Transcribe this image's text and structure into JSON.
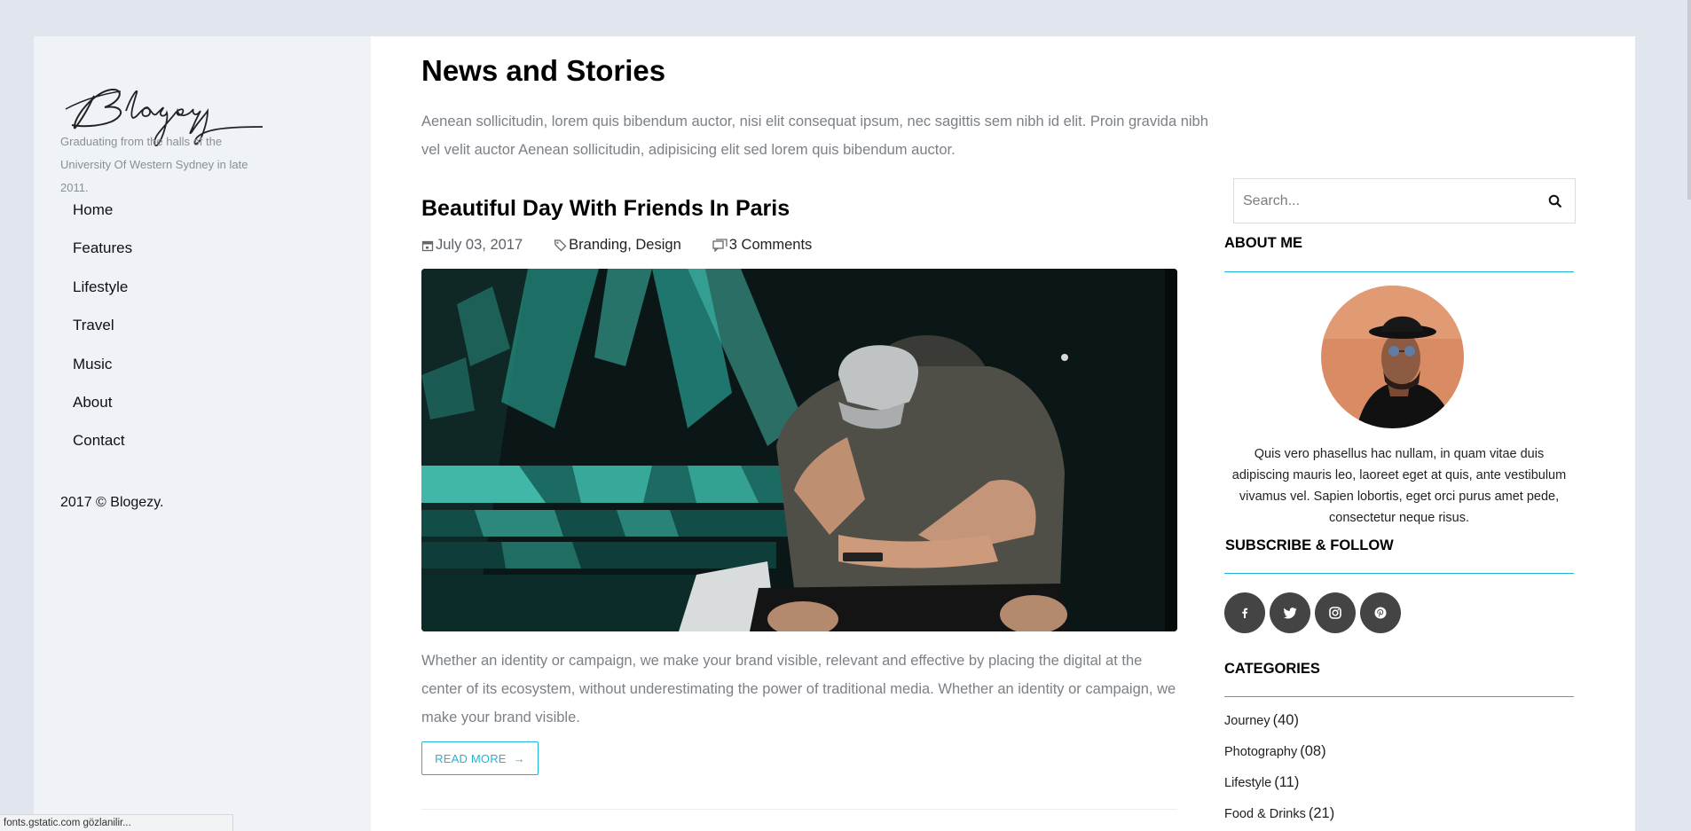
{
  "sidebar": {
    "logo_text": "Blogezy",
    "tagline": "Graduating from the halls of the University Of Western Sydney in late 2011.",
    "nav": [
      "Home",
      "Features",
      "Lifestyle",
      "Travel",
      "Music",
      "About",
      "Contact"
    ],
    "copyright": "2017 © Blogezy."
  },
  "main": {
    "title": "News and Stories",
    "intro": "Aenean sollicitudin, lorem quis bibendum auctor, nisi elit consequat ipsum, nec sagittis sem nibh id elit. Proin gravida nibh vel velit auctor Aenean sollicitudin, adipisicing elit sed lorem quis bibendum auctor.",
    "post": {
      "title": "Beautiful Day With Friends In Paris",
      "date": "July 03, 2017",
      "tag1": "Branding",
      "tag_sep": ", ",
      "tag2": "Design",
      "comments": "3 Comments",
      "excerpt": "Whether an identity or campaign, we make your brand visible, relevant and effective by placing the digital at the center of its ecosystem, without underestimating the power of traditional media. Whether an identity or campaign, we make your brand visible.",
      "read_more": "READ MORE",
      "image_icon": "man-with-cap-looking-at-phone-photo"
    }
  },
  "widgets": {
    "search_placeholder": "Search...",
    "about_title": "ABOUT ME",
    "about_text": "Quis vero phasellus hac nullam, in quam vitae duis adipiscing mauris leo, laoreet eget at quis, ante vestibulum vivamus vel. Sapien lobortis, eget orci purus amet pede, consectetur neque risus.",
    "subscribe_title": "SUBSCRIBE & FOLLOW",
    "socials": [
      {
        "icon": "facebook-icon",
        "glyph": "f"
      },
      {
        "icon": "twitter-icon",
        "glyph": ""
      },
      {
        "icon": "instagram-icon",
        "glyph": ""
      },
      {
        "icon": "pinterest-icon",
        "glyph": ""
      }
    ],
    "categories_title": "CATEGORIES",
    "categories": [
      {
        "name": "Journey",
        "count": "(40)"
      },
      {
        "name": "Photography",
        "count": "(08)"
      },
      {
        "name": "Lifestyle",
        "count": "(11)"
      },
      {
        "name": "Food & Drinks",
        "count": "(21)"
      }
    ]
  },
  "statusbar": {
    "text": "fonts.gstatic.com gözlanilir..."
  },
  "colors": {
    "accent": "#1fb5d6",
    "page_bg": "#e1e6ee",
    "sidebar_bg": "#eff3f7",
    "social_bg": "#444444"
  }
}
